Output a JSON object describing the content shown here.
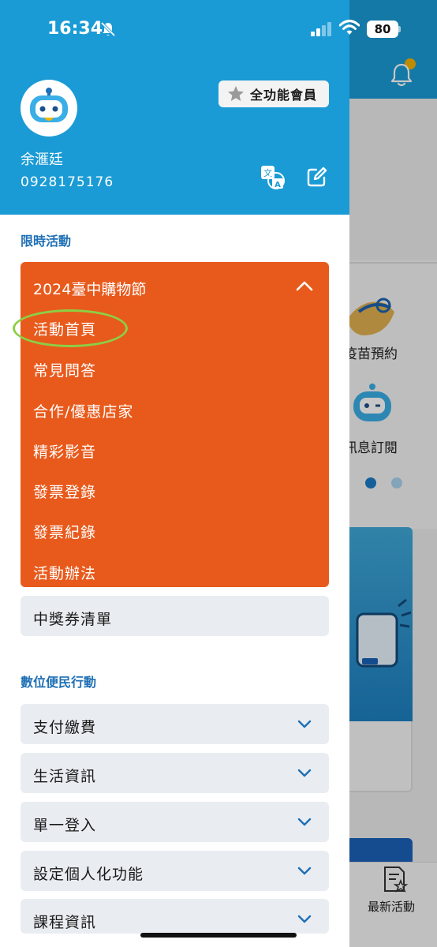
{
  "status_bar": {
    "time": "16:34",
    "battery": "80"
  },
  "profile": {
    "member_badge": "全功能會員",
    "name": "余滙廷",
    "phone": "0928175176"
  },
  "sections": {
    "limited_events": "限時活動",
    "digital_services": "數位便民行動"
  },
  "promo_group": {
    "title": "2024臺中購物節",
    "items": [
      "活動首頁",
      "常見問答",
      "合作/優惠店家",
      "精彩影音",
      "發票登錄",
      "發票紀錄",
      "活動辦法"
    ]
  },
  "coupon_row": "中獎券清單",
  "service_rows": [
    "支付繳費",
    "生活資訊",
    "單一登入",
    "設定個人化功能",
    "課程資訊"
  ],
  "background": {
    "label_1": "疫苗預約",
    "label_2": "訊息訂閱",
    "tab_label": "最新活動"
  },
  "colors": {
    "header_blue": "#1a9bd5",
    "promo_orange": "#e85a1c",
    "section_blue": "#1e6fb5",
    "row_gray": "#e9edf1",
    "highlight_green": "#8ccf44"
  },
  "icons": {
    "mute": "bell-slash-icon",
    "signal": "cellular-signal-icon",
    "wifi": "wifi-icon",
    "avatar": "robot-avatar-icon",
    "star": "star-icon",
    "translate": "translate-icon",
    "edit": "edit-icon",
    "chevron_up": "chevron-up-icon",
    "chevron_down": "chevron-down-icon",
    "bell": "bell-icon",
    "tab": "document-star-icon"
  }
}
